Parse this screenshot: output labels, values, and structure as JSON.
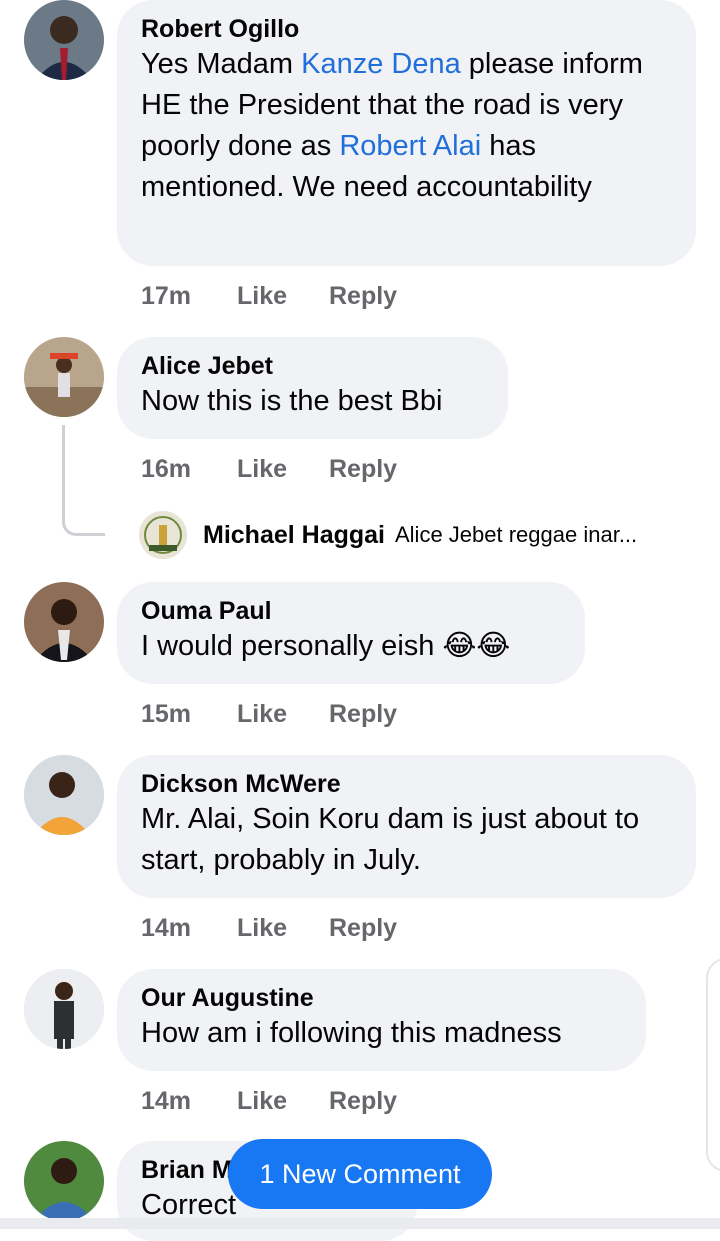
{
  "comments": [
    {
      "name": "Robert Ogillo",
      "text_parts": [
        "Yes Madam ",
        "Kanze Dena",
        " please inform HE the President that the road is very poorly done as ",
        "Robert Alai",
        " has mentioned. We need accountability"
      ],
      "time": "17m",
      "like": "Like",
      "reply": "Reply"
    },
    {
      "name": "Alice Jebet",
      "text": "Now this is the best Bbi",
      "time": "16m",
      "like": "Like",
      "reply": "Reply"
    },
    {
      "name": "Ouma Paul",
      "text": "I would personally eish",
      "emoji": "😂😂",
      "time": "15m",
      "like": "Like",
      "reply": "Reply"
    },
    {
      "name": "Dickson McWere",
      "text": "Mr. Alai, Soin Koru dam is just about to start, probably in July.",
      "time": "14m",
      "like": "Like",
      "reply": "Reply"
    },
    {
      "name": "Our Augustine",
      "text": "How am i following this madness",
      "time": "14m",
      "like": "Like",
      "reply": "Reply"
    },
    {
      "name": "Brian M",
      "text": "Correct"
    }
  ],
  "reply_preview": {
    "name": "Michael Haggai",
    "text": "Alice Jebet reggae inar..."
  },
  "new_comment_button": "1 New Comment",
  "colors": {
    "mention": "#216fdb",
    "bubble": "#f0f2f5",
    "accent": "#1877f2"
  }
}
